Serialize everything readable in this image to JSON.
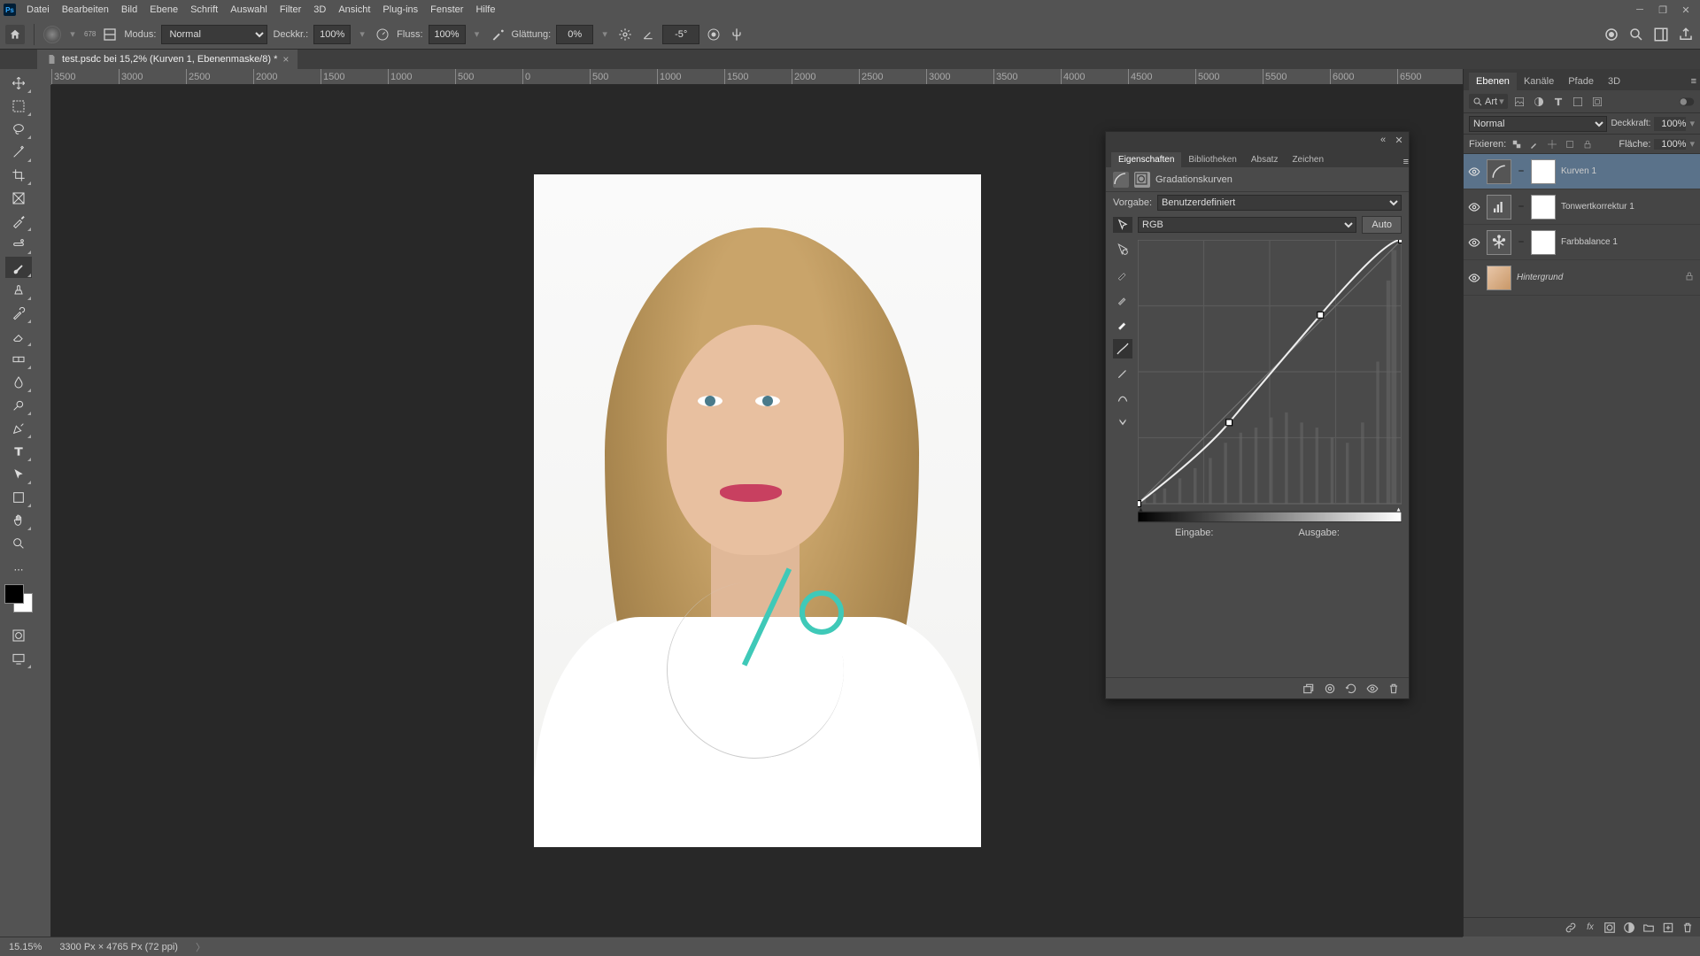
{
  "menu": {
    "items": [
      "Datei",
      "Bearbeiten",
      "Bild",
      "Ebene",
      "Schrift",
      "Auswahl",
      "Filter",
      "3D",
      "Ansicht",
      "Plug-ins",
      "Fenster",
      "Hilfe"
    ]
  },
  "options": {
    "brush_size": "678",
    "mode_label": "Modus:",
    "mode_value": "Normal",
    "opacity_label": "Deckkr.:",
    "opacity_value": "100%",
    "flow_label": "Fluss:",
    "flow_value": "100%",
    "smoothing_label": "Glättung:",
    "smoothing_value": "0%",
    "angle_value": "-5°"
  },
  "document": {
    "tab_title": "test.psdc bei 15,2% (Kurven 1, Ebenenmaske/8) *"
  },
  "ruler_ticks": [
    "3500",
    "3000",
    "2500",
    "2000",
    "1500",
    "1000",
    "500",
    "0",
    "500",
    "1000",
    "1500",
    "2000",
    "2500",
    "3000",
    "3500",
    "4000",
    "4500",
    "5000",
    "5500",
    "6000",
    "6500"
  ],
  "properties": {
    "tabs": [
      "Eigenschaften",
      "Bibliotheken",
      "Absatz",
      "Zeichen"
    ],
    "adj_name": "Gradationskurven",
    "preset_label": "Vorgabe:",
    "preset_value": "Benutzerdefiniert",
    "channel_value": "RGB",
    "auto_label": "Auto",
    "input_label": "Eingabe:",
    "output_label": "Ausgabe:"
  },
  "chart_data": {
    "type": "line",
    "title": "Gradationskurven",
    "xlabel": "Eingabe",
    "ylabel": "Ausgabe",
    "xlim": [
      0,
      255
    ],
    "ylim": [
      0,
      255
    ],
    "series": [
      {
        "name": "RGB Kurve",
        "points": [
          [
            0,
            0
          ],
          [
            88,
            78
          ],
          [
            178,
            182
          ],
          [
            255,
            255
          ]
        ]
      }
    ],
    "histogram_note": "Hintergrund-Histogramm mit Spitze bei hohen Tonwerten (~240-255)"
  },
  "layers_panel": {
    "tabs": [
      "Ebenen",
      "Kanäle",
      "Pfade",
      "3D"
    ],
    "filter_kind": "Art",
    "blend_mode": "Normal",
    "opacity_label": "Deckkraft:",
    "opacity_value": "100%",
    "lock_label": "Fixieren:",
    "fill_label": "Fläche:",
    "fill_value": "100%",
    "layers": [
      {
        "name": "Kurven 1",
        "type": "curves",
        "selected": true,
        "has_mask": true,
        "visible": true
      },
      {
        "name": "Tonwertkorrektur 1",
        "type": "levels",
        "selected": false,
        "has_mask": true,
        "visible": true
      },
      {
        "name": "Farbbalance 1",
        "type": "colorbalance",
        "selected": false,
        "has_mask": true,
        "visible": true
      },
      {
        "name": "Hintergrund",
        "type": "image",
        "selected": false,
        "locked": true,
        "visible": true
      }
    ]
  },
  "status": {
    "zoom": "15.15%",
    "dimensions": "3300 Px × 4765 Px (72 ppi)"
  },
  "icons": {
    "home": "⌂",
    "search": "⌕",
    "eye": "👁",
    "lock": "🔒",
    "trash": "🗑",
    "plus": "＋",
    "folder": "📁",
    "mask": "◯",
    "fx": "fx",
    "link": "⛓",
    "reset": "↺",
    "clip": "⎘"
  }
}
